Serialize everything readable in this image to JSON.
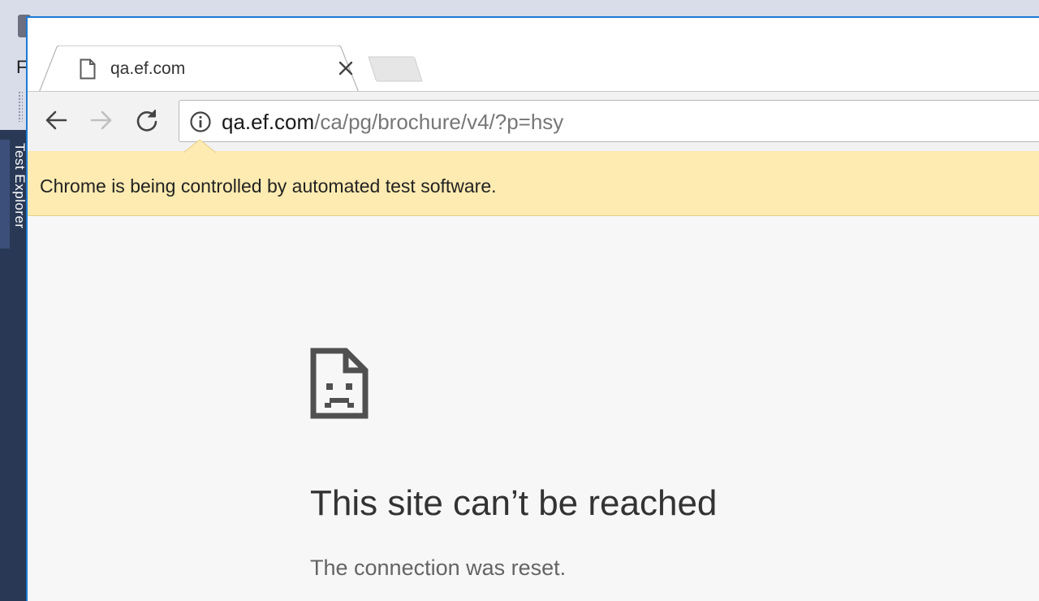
{
  "background_app": {
    "menu_letter": "F",
    "side_panel_label": "Test Explorer"
  },
  "browser": {
    "tab": {
      "title": "qa.ef.com",
      "favicon": "page-icon",
      "close_icon": "close-icon"
    },
    "toolbar": {
      "back_icon": "arrow-left-icon",
      "forward_icon": "arrow-right-icon",
      "reload_icon": "reload-icon"
    },
    "omnibox": {
      "security_icon": "info-icon",
      "url_host": "qa.ef.com",
      "url_path": "/ca/pg/brochure/v4/?p=hsy"
    },
    "infobar": {
      "text": "Chrome is being controlled by automated test software."
    }
  },
  "error_page": {
    "icon": "sad-page-icon",
    "title": "This site can’t be reached",
    "subtitle": "The connection was reset."
  },
  "colors": {
    "infobar_bg": "#feebb1",
    "ide_sidebar": "#293955",
    "window_border": "#1c7ad4"
  }
}
